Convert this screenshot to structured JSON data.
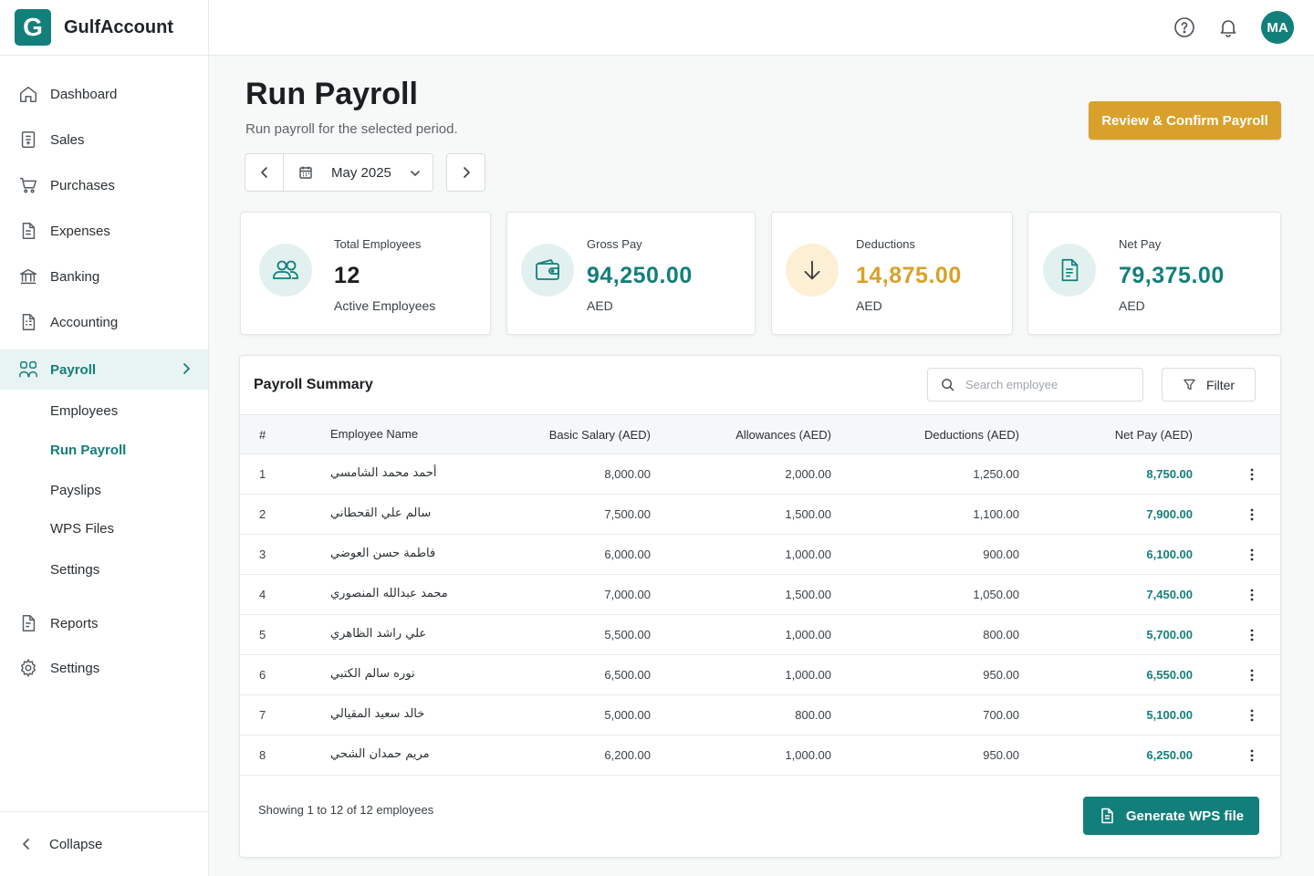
{
  "app": {
    "logo_letter": "G",
    "name": "GulfAccount"
  },
  "topbar": {
    "help_icon": "help-circle-icon",
    "bell_icon": "bell-icon",
    "avatar_initials": "MA"
  },
  "sidebar": {
    "items": [
      {
        "label": "Dashboard",
        "icon": "home-icon"
      },
      {
        "label": "Sales",
        "icon": "receipt-icon"
      },
      {
        "label": "Purchases",
        "icon": "cart-icon"
      },
      {
        "label": "Expenses",
        "icon": "document-icon"
      },
      {
        "label": "Banking",
        "icon": "bank-icon"
      },
      {
        "label": "Accounting",
        "icon": "ledger-icon"
      },
      {
        "label": "Payroll",
        "icon": "people-icon",
        "active": true
      },
      {
        "label": "Reports",
        "icon": "report-icon"
      },
      {
        "label": "Settings",
        "icon": "gear-icon"
      }
    ],
    "payroll_sub": [
      {
        "label": "Employees"
      },
      {
        "label": "Run Payroll",
        "active": true
      },
      {
        "label": "Payslips"
      },
      {
        "label": "WPS Files"
      },
      {
        "label": "Settings"
      }
    ],
    "collapse_label": "Collapse"
  },
  "page": {
    "title": "Run Payroll",
    "subtitle": "Run payroll for the selected period.",
    "primary_action": "Review & Confirm Payroll",
    "period": "May 2025"
  },
  "stats": [
    {
      "label": "Total Employees",
      "value": "12",
      "note": "Active Employees",
      "icon": "people-icon"
    },
    {
      "label": "Gross Pay",
      "value": "94,250.00",
      "note": "AED",
      "icon": "wallet-icon"
    },
    {
      "label": "Deductions",
      "value": "14,875.00",
      "note": "AED",
      "icon": "arrow-down-icon"
    },
    {
      "label": "Net Pay",
      "value": "79,375.00",
      "note": "AED",
      "icon": "payslip-icon"
    }
  ],
  "summary": {
    "title": "Payroll Summary",
    "search_placeholder": "Search employee",
    "filter_label": "Filter",
    "columns": [
      "#",
      "Employee Name",
      "Basic Salary (AED)",
      "Allowances (AED)",
      "Deductions (AED)",
      "Net Pay (AED)"
    ],
    "rows": [
      {
        "no": "1",
        "name": "أحمد محمد الشامسي",
        "basic": "8,000.00",
        "allowances": "2,000.00",
        "deductions": "1,250.00",
        "net": "8,750.00"
      },
      {
        "no": "2",
        "name": "سالم علي القحطاني",
        "basic": "7,500.00",
        "allowances": "1,500.00",
        "deductions": "1,100.00",
        "net": "7,900.00"
      },
      {
        "no": "3",
        "name": "فاطمة حسن العوضي",
        "basic": "6,000.00",
        "allowances": "1,000.00",
        "deductions": "900.00",
        "net": "6,100.00"
      },
      {
        "no": "4",
        "name": "محمد عبدالله المنصوري",
        "basic": "7,000.00",
        "allowances": "1,500.00",
        "deductions": "1,050.00",
        "net": "7,450.00"
      },
      {
        "no": "5",
        "name": "علي راشد الظاهري",
        "basic": "5,500.00",
        "allowances": "1,000.00",
        "deductions": "800.00",
        "net": "5,700.00"
      },
      {
        "no": "6",
        "name": "نوره سالم الكتبي",
        "basic": "6,500.00",
        "allowances": "1,000.00",
        "deductions": "950.00",
        "net": "6,550.00"
      },
      {
        "no": "7",
        "name": "خالد سعيد المقيالي",
        "basic": "5,000.00",
        "allowances": "800.00",
        "deductions": "700.00",
        "net": "5,100.00"
      },
      {
        "no": "8",
        "name": "مريم حمدان الشحي",
        "basic": "6,200.00",
        "allowances": "1,000.00",
        "deductions": "950.00",
        "net": "6,250.00"
      }
    ],
    "showing_text": "Showing 1 to 12 of 12 employees",
    "wps_button": "Generate WPS file"
  },
  "colors": {
    "brand_teal": "#137f7a",
    "accent_gold": "#d9a12b"
  }
}
